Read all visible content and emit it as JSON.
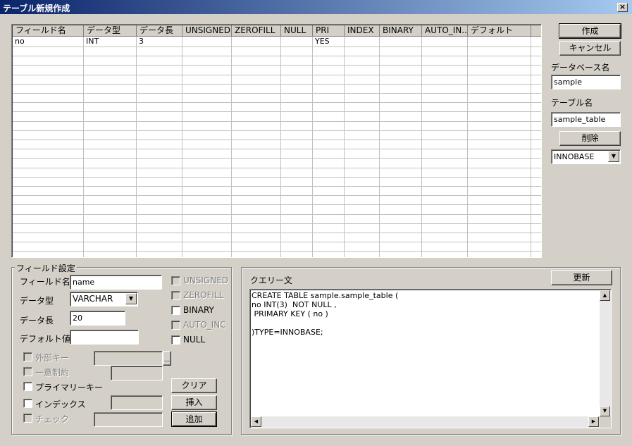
{
  "window": {
    "title": "テーブル新規作成",
    "close": "×"
  },
  "grid": {
    "columns": [
      "フィールド名",
      "データ型",
      "データ長",
      "UNSIGNED",
      "ZEROFILL",
      "NULL",
      "PRI",
      "INDEX",
      "BINARY",
      "AUTO_IN...",
      "デフォルト"
    ],
    "rows": [
      [
        "no",
        "INT",
        "3",
        "",
        "",
        "",
        "YES",
        "",
        "",
        "",
        ""
      ]
    ]
  },
  "right": {
    "create_button": "作成",
    "cancel_button": "キャンセル",
    "database_label": "データベース名",
    "database_value": "sample",
    "table_label": "テーブル名",
    "table_value": "sample_table",
    "delete_button": "削除",
    "engine_value": "INNOBASE"
  },
  "field_settings": {
    "legend": "フィールド設定",
    "name_label": "フィールド名",
    "name_value": "name",
    "type_label": "データ型",
    "type_value": "VARCHAR",
    "length_label": "データ長",
    "length_value": "20",
    "default_label": "デフォルト値",
    "default_value": "",
    "unsigned": "UNSIGNED",
    "zerofill": "ZEROFILL",
    "binary": "BINARY",
    "auto_inc": "AUTO_INC",
    "null": "NULL",
    "foreign_key": "外部キー",
    "unique": "一意制約",
    "primary_key": "プライマリーキー",
    "index": "インデックス",
    "check": "チェック",
    "browse": "...",
    "clear_button": "クリア",
    "insert_button": "挿入",
    "add_button": "追加"
  },
  "query": {
    "label": "クエリー文",
    "update_button": "更新",
    "lines": [
      "CREATE TABLE sample.sample_table (",
      "no INT(3)  NOT NULL ,",
      " PRIMARY KEY ( no )",
      "",
      ")TYPE=INNOBASE;"
    ]
  }
}
